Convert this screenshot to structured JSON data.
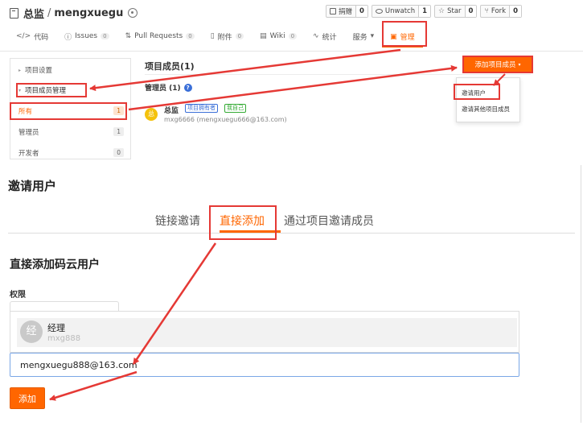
{
  "repo": {
    "owner": "总监",
    "separator": "/",
    "name": "mengxuegu",
    "actions": [
      {
        "label": "捐赠",
        "count": "0",
        "icon": "donate-icon"
      },
      {
        "label": "Unwatch",
        "count": "1",
        "icon": "eye-icon"
      },
      {
        "label": "Star",
        "count": "0",
        "icon": "star-icon"
      },
      {
        "label": "Fork",
        "count": "0",
        "icon": "fork-icon"
      }
    ],
    "tabs": [
      {
        "label": "代码",
        "icon": "code-icon"
      },
      {
        "label": "Issues",
        "badge": "0",
        "icon": "issue-icon"
      },
      {
        "label": "Pull Requests",
        "badge": "0",
        "icon": "pull-request-icon"
      },
      {
        "label": "附件",
        "badge": "0",
        "icon": "attachment-icon"
      },
      {
        "label": "Wiki",
        "badge": "0",
        "icon": "wiki-icon"
      },
      {
        "label": "统计",
        "icon": "stats-icon"
      },
      {
        "label": "服务",
        "icon": "service-icon"
      },
      {
        "label": "管理",
        "icon": "manage-icon"
      }
    ]
  },
  "sidebar": {
    "items": [
      {
        "label": "项目设置"
      },
      {
        "label": "项目成员管理"
      },
      {
        "label": "所有",
        "count": "1"
      },
      {
        "label": "管理员",
        "count": "1"
      },
      {
        "label": "开发者",
        "count": "0"
      }
    ]
  },
  "members": {
    "title": "项目成员(1)",
    "admin_title": "管理员 (1)",
    "help": "?",
    "add_button": "添加项目成员",
    "dropdown": [
      "邀请用户",
      "邀请其他项目成员"
    ],
    "rows": [
      {
        "avatar": "总",
        "name": "总监",
        "tags": [
          "项目拥有者",
          "我自己"
        ],
        "sub": "mxg6666 (mengxuegu666@163.com)"
      }
    ]
  },
  "invite": {
    "title": "邀请用户",
    "tabs": [
      "链接邀请",
      "直接添加",
      "通过项目邀请成员"
    ],
    "section_title": "直接添加码云用户",
    "permission_label": "权限",
    "suggestion": {
      "avatar": "经",
      "name": "经理",
      "username": "mxg888"
    },
    "email_value": "mengxuegu888@163.com",
    "submit": "添加"
  },
  "colors": {
    "accent": "#ff6600",
    "annotation": "#e53935",
    "link": "#3a6fd8"
  }
}
